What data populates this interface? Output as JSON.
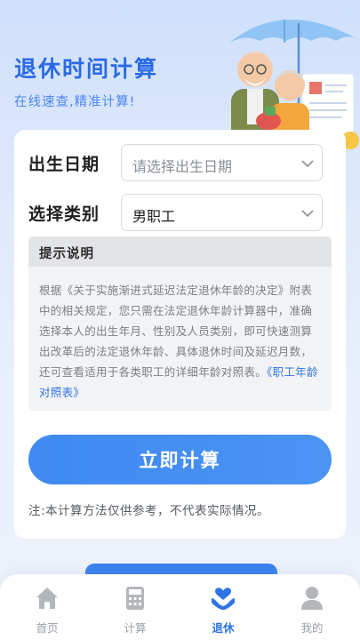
{
  "hero": {
    "title": "退休时间计算",
    "subtitle": "在线速查,精准计算!"
  },
  "form": {
    "birth": {
      "label": "出生日期",
      "placeholder": "请选择出生日期"
    },
    "category": {
      "label": "选择类别",
      "value": "男职工"
    }
  },
  "tip": {
    "title": "提示说明",
    "body": "根据《关于实施渐进式延迟法定退休年龄的决定》附表中的相关规定，您只需在法定退休年龄计算器中，准确选择本人的出生年月、性别及人员类别，即可快速测算出改革后的法定退休年龄、具体退休时间及延迟月数，还可查看适用于各类职工的详细年龄对照表。",
    "link": "《职工年龄对照表》"
  },
  "calculate_label": "立即计算",
  "note": "注:本计算方法仅供参考，不代表实际情况。",
  "tabs": [
    {
      "label": "首页",
      "icon": "home-icon",
      "active": false
    },
    {
      "label": "计算",
      "icon": "calculator-icon",
      "active": false
    },
    {
      "label": "退休",
      "icon": "heart-hands-icon",
      "active": true
    },
    {
      "label": "我的",
      "icon": "person-icon",
      "active": false
    }
  ],
  "colors": {
    "accent": "#2f73e6",
    "button": "#4189f2",
    "tab_inactive": "#b3b6bb"
  }
}
